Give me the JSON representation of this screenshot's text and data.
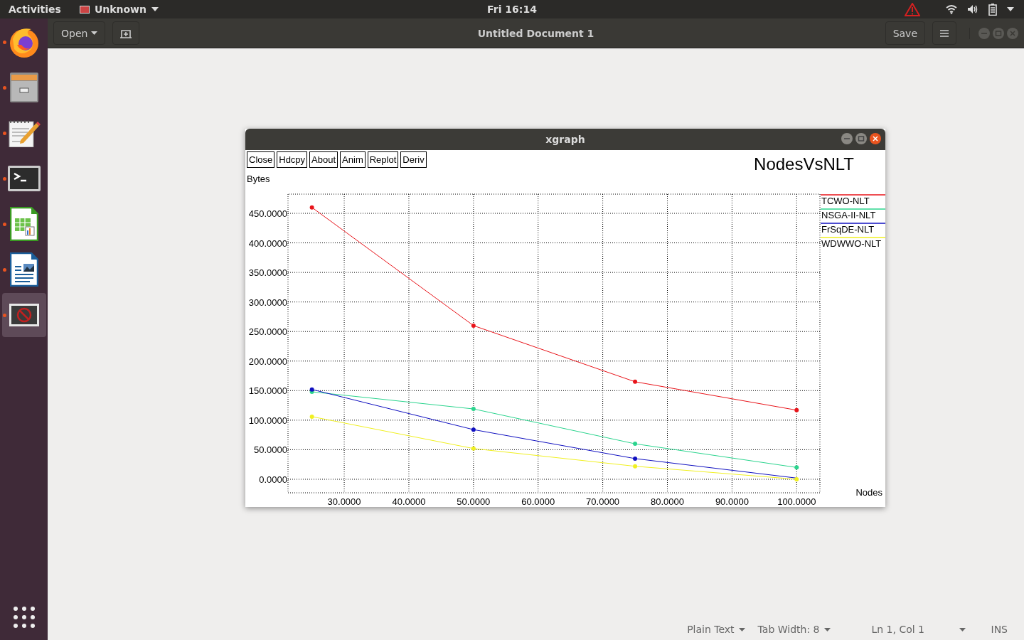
{
  "top_bar": {
    "activities": "Activities",
    "app_menu": "Unknown",
    "clock": "Fri 16:14"
  },
  "dock": [
    {
      "kind": "browser",
      "running": true,
      "active": false
    },
    {
      "kind": "files",
      "running": true,
      "active": false
    },
    {
      "kind": "editor",
      "running": true,
      "active": false
    },
    {
      "kind": "terminal",
      "running": true,
      "active": false
    },
    {
      "kind": "spreadsheet",
      "running": true,
      "active": false
    },
    {
      "kind": "writer",
      "running": true,
      "active": false
    },
    {
      "kind": "unknown",
      "running": true,
      "active": true
    }
  ],
  "editor": {
    "open_button": "Open",
    "title": "Untitled Document 1",
    "save_button": "Save"
  },
  "xgraph": {
    "title": "xgraph",
    "buttons": [
      "Close",
      "Hdcpy",
      "About",
      "Anim",
      "Replot",
      "Deriv"
    ],
    "chart_data": {
      "type": "line",
      "title": "NodesVsNLT",
      "xlabel": "Nodes",
      "ylabel": "Bytes",
      "x": [
        25,
        50,
        75,
        100
      ],
      "grid": true,
      "series": [
        {
          "name": "TCWO-NLT",
          "color": "#e8141a",
          "marker": "circle",
          "values": [
            460,
            260,
            165,
            117
          ]
        },
        {
          "name": "NSGA-II-NLT",
          "color": "#2bd48e",
          "marker": "circle",
          "values": [
            148,
            119,
            60,
            20
          ]
        },
        {
          "name": "FrSqDE-NLT",
          "color": "#1010c0",
          "marker": "circle",
          "values": [
            152,
            84,
            35,
            2
          ]
        },
        {
          "name": "WDWWO-NLT",
          "color": "#f0f020",
          "marker": "circle",
          "values": [
            106,
            52,
            22,
            0
          ]
        }
      ],
      "xlim": [
        21.3,
        103.6
      ],
      "ylim": [
        -22.9,
        482.5
      ],
      "xticks": [
        {
          "value": 30,
          "label": "30.0000"
        },
        {
          "value": 40,
          "label": "40.0000"
        },
        {
          "value": 50,
          "label": "50.0000"
        },
        {
          "value": 60,
          "label": "60.0000"
        },
        {
          "value": 70,
          "label": "70.0000"
        },
        {
          "value": 80,
          "label": "80.0000"
        },
        {
          "value": 90,
          "label": "90.0000"
        },
        {
          "value": 100,
          "label": "100.0000"
        }
      ],
      "yticks": [
        {
          "value": 0,
          "label": "0.0000"
        },
        {
          "value": 50,
          "label": "50.0000"
        },
        {
          "value": 100,
          "label": "100.0000"
        },
        {
          "value": 150,
          "label": "150.0000"
        },
        {
          "value": 200,
          "label": "200.0000"
        },
        {
          "value": 250,
          "label": "250.0000"
        },
        {
          "value": 300,
          "label": "300.0000"
        },
        {
          "value": 350,
          "label": "350.0000"
        },
        {
          "value": 400,
          "label": "400.0000"
        },
        {
          "value": 450,
          "label": "450.0000"
        }
      ]
    }
  },
  "status_bar": {
    "language": "Plain Text",
    "tab_width": "Tab Width: 8",
    "position": "Ln 1, Col 1",
    "mode": "INS"
  }
}
